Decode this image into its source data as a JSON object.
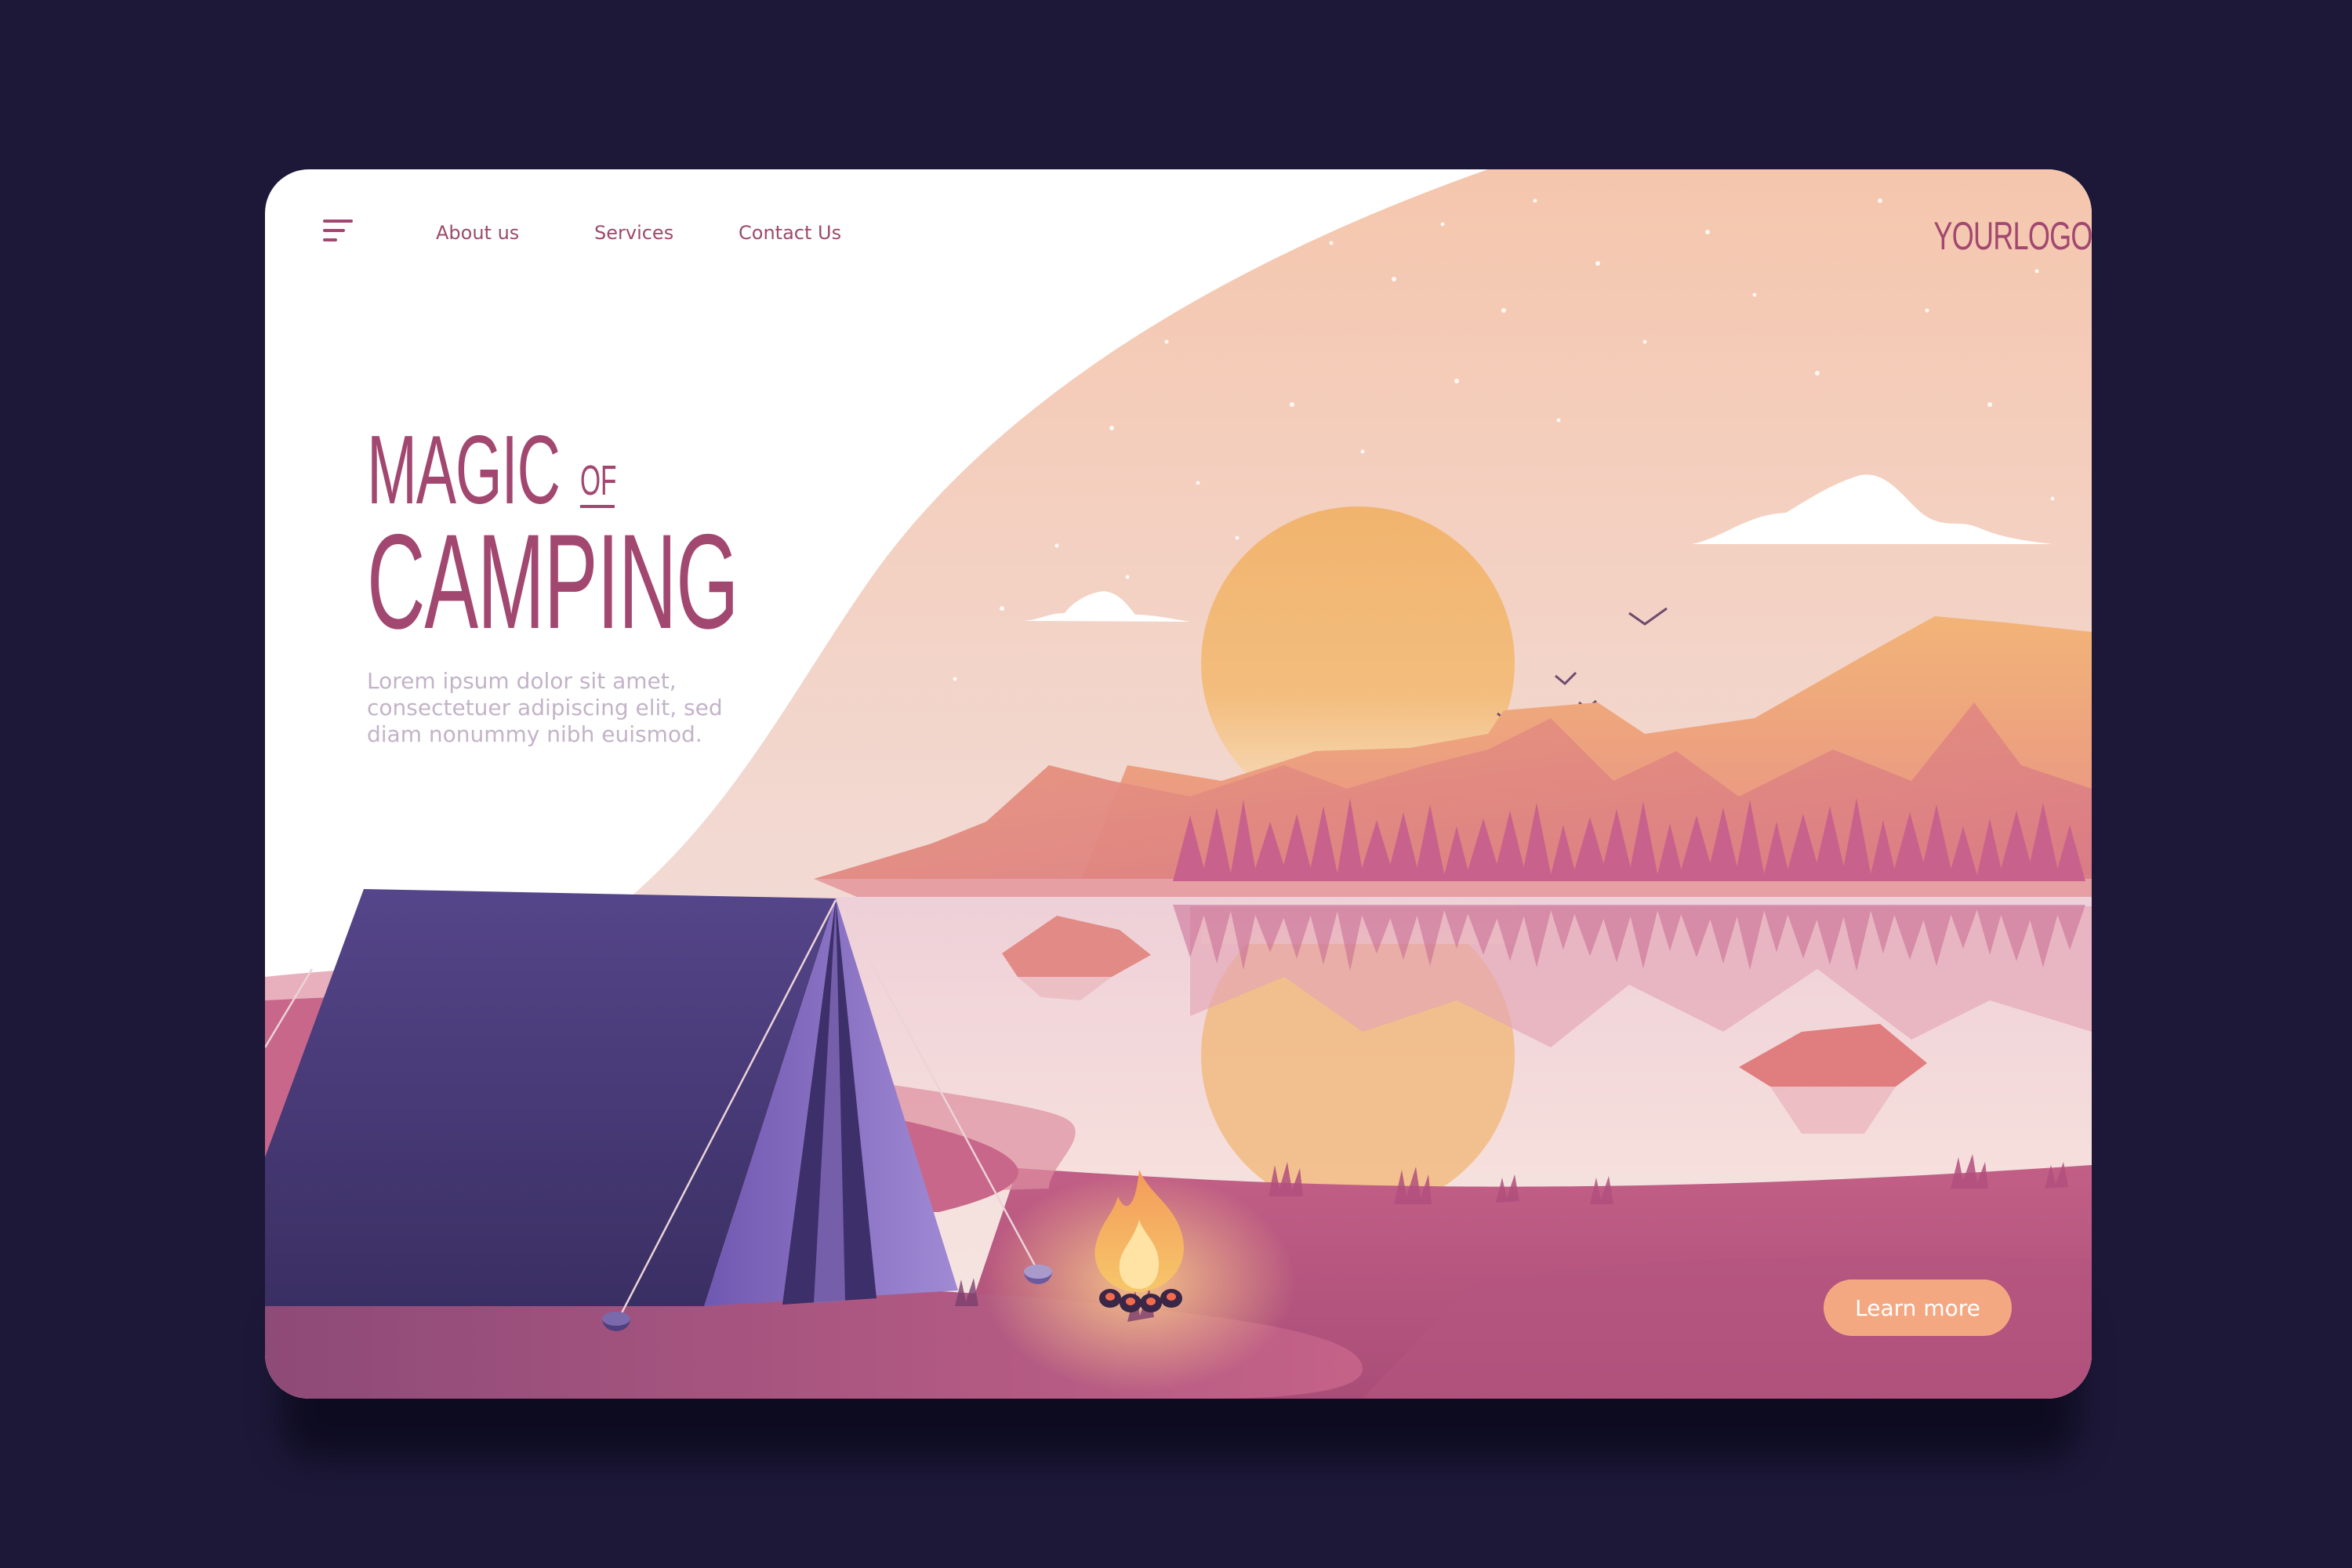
{
  "nav": {
    "menu_icon": "hamburger-menu-icon",
    "links": [
      "About us",
      "Services",
      "Contact Us"
    ],
    "logo": "YOURLOGO"
  },
  "hero": {
    "title_line1": "MAGIC",
    "title_small": "OF",
    "title_line2": "CAMPING",
    "body": "Lorem ipsum dolor sit amet, consectetuer adipiscing elit, sed diam nonummy nibh euismod."
  },
  "cta": {
    "label": "Learn more"
  },
  "colors": {
    "page_background": "#1d1838",
    "brand": "#a24870",
    "button": "#f4a882",
    "sun": "#f1b46e",
    "tent": "#4f3f7e"
  },
  "illustration": {
    "icons": [
      "tent-icon",
      "campfire-icon",
      "sun-icon",
      "cloud-icon",
      "bird-icon",
      "mountain-icon",
      "pine-tree-icon"
    ]
  }
}
